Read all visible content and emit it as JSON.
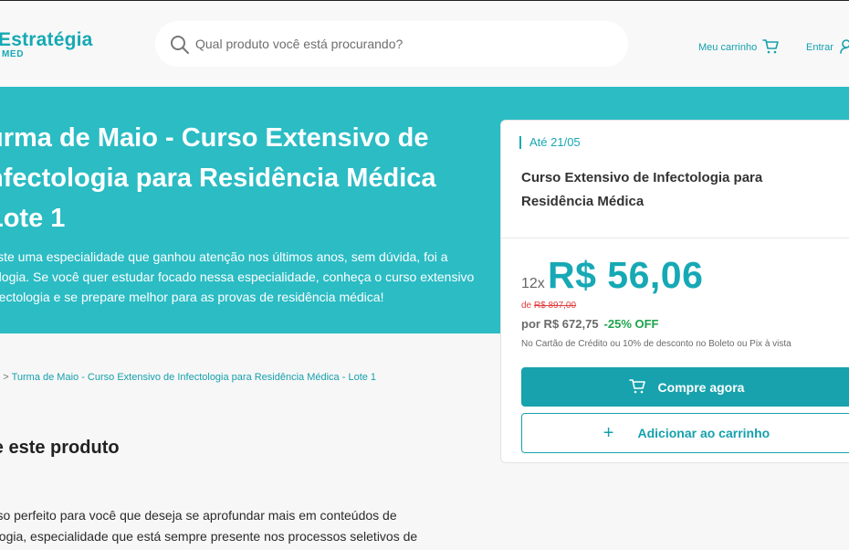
{
  "header": {
    "logo_text": "Estratégia",
    "logo_sub": "MED",
    "search_placeholder": "Qual produto você está procurando?",
    "cart_label": "Meu carrinho",
    "login_label": "Entrar"
  },
  "hero": {
    "title": "urma de Maio - Curso Extensivo de nfectologia para Residência Médica Lote 1",
    "title_lines": [
      "urma de Maio - Curso Extensivo de",
      "nfectologia para Residência Médica",
      "Lote 1"
    ],
    "description_lines": [
      "xiste uma especialidade que ganhou atenção nos últimos anos, sem dúvida, foi a",
      "tologia. Se você quer estudar focado nessa especialidade, conheça o curso extensivo",
      "nfectologia e se prepare melhor para as provas de residência médica!"
    ]
  },
  "breadcrumb": {
    "prefix": "go > ",
    "current": "Turma de Maio - Curso Extensivo de Infectologia para Residência Médica - Lote 1"
  },
  "section": {
    "title": "re este produto",
    "body_lines": [
      "urso perfeito para você que deseja se aprofundar mais em conteúdos de",
      "tologia, especialidade que está sempre presente nos processos seletivos de"
    ]
  },
  "card": {
    "date_label": "Até 21/05",
    "product_title": "Curso Extensivo de Infectologia para Residência Médica",
    "installments": "12x",
    "price": "R$ 56,06",
    "old_price_prefix": "de ",
    "old_price": "R$ 897,00",
    "full_price": "por R$ 672,75",
    "discount": "-25% OFF",
    "payment_note": "No Cartão de Crédito ou 10% de desconto no Boleto ou Pix à vista",
    "buy_label": "Compre agora",
    "add_label": "Adicionar ao carrinho",
    "plus_symbol": "+"
  },
  "colors": {
    "brand": "#16a9b5",
    "hero_bg": "#2bbcc4",
    "button": "#18a2ad",
    "discount": "#1ea34c",
    "old_price": "#e03e3e"
  },
  "icons": [
    "search-icon",
    "cart-icon",
    "user-icon",
    "cart-button-icon",
    "plus-icon"
  ]
}
